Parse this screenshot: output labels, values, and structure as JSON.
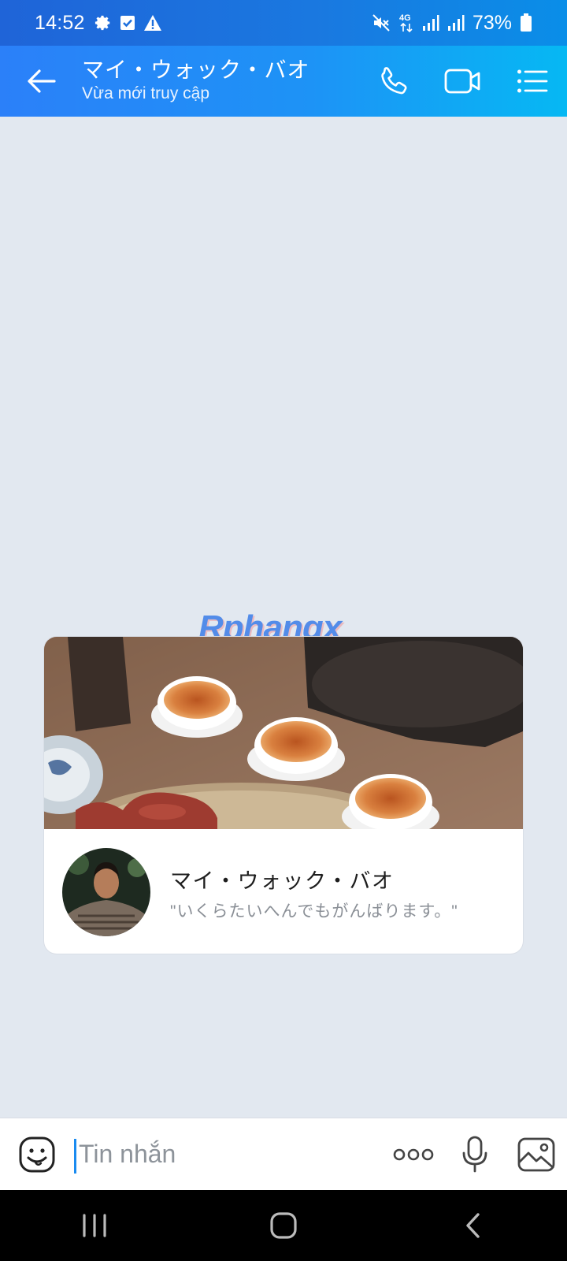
{
  "status_bar": {
    "time": "14:52",
    "battery": "73%",
    "network": "4G",
    "left_icons": [
      "gear-icon",
      "check-square-icon",
      "warning-icon"
    ],
    "right_icons": [
      "mute-icon",
      "network-4g-icon",
      "signal-icon",
      "signal-icon",
      "battery-icon"
    ]
  },
  "header": {
    "title": "マイ・ウォック・バオ",
    "subtitle": "Vừa mới truy cập",
    "icons": [
      "back-arrow-icon",
      "phone-icon",
      "video-camera-icon",
      "menu-list-icon"
    ]
  },
  "watermark": "Rphangx",
  "profile_card": {
    "name": "マイ・ウォック・バオ",
    "status": "\"いくらたいへんでもがんばります。\""
  },
  "composer": {
    "placeholder": "Tin nhắn",
    "icons": [
      "sticker-icon",
      "more-dots-icon",
      "microphone-icon",
      "image-icon"
    ]
  },
  "colors": {
    "header_start": "#2b80f9",
    "header_end": "#06b8f3",
    "chat_background": "#e2e8f0",
    "caret": "#1a8bf0"
  }
}
